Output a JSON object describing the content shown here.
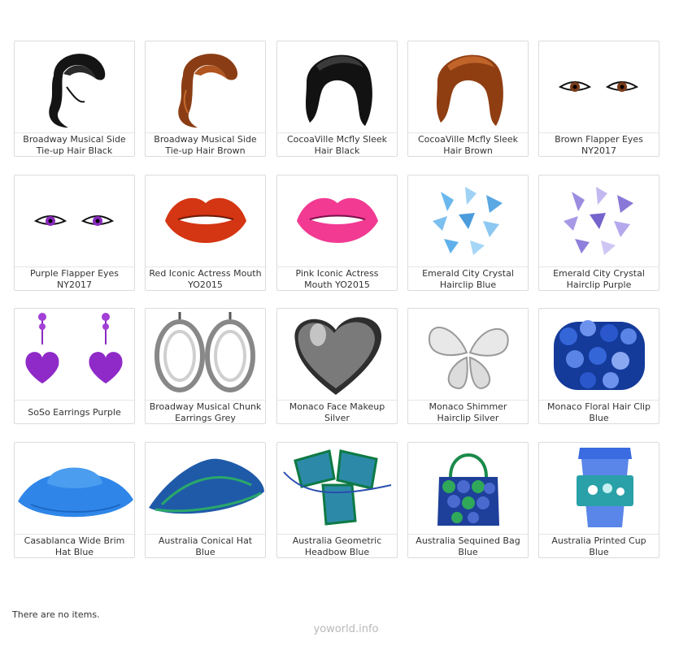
{
  "items": [
    {
      "name": "Broadway Musical Side Tie-up Hair Black",
      "icon": "black-side-hair-icon"
    },
    {
      "name": "Broadway Musical Side Tie-up Hair Brown",
      "icon": "brown-side-hair-icon"
    },
    {
      "name": "CocoaVille Mcfly Sleek Hair Black",
      "icon": "black-sleek-hair-icon"
    },
    {
      "name": "CocoaVille Mcfly Sleek Hair Brown",
      "icon": "brown-sleek-hair-icon"
    },
    {
      "name": "Brown Flapper Eyes NY2017",
      "icon": "brown-eyes-icon"
    },
    {
      "name": "Purple Flapper Eyes NY2017",
      "icon": "purple-eyes-icon"
    },
    {
      "name": "Red Iconic Actress Mouth YO2015",
      "icon": "red-lips-icon"
    },
    {
      "name": "Pink Iconic Actress Mouth YO2015",
      "icon": "pink-lips-icon"
    },
    {
      "name": "Emerald City Crystal Hairclip Blue",
      "icon": "blue-crystal-hairclip-icon"
    },
    {
      "name": "Emerald City Crystal Hairclip Purple",
      "icon": "purple-crystal-hairclip-icon"
    },
    {
      "name": "SoSo Earrings Purple",
      "icon": "purple-heart-earrings-icon"
    },
    {
      "name": "Broadway Musical Chunk Earrings Grey",
      "icon": "grey-chunk-earrings-icon"
    },
    {
      "name": "Monaco Face Makeup Silver",
      "icon": "silver-heart-makeup-icon"
    },
    {
      "name": "Monaco Shimmer Hairclip Silver",
      "icon": "silver-butterfly-hairclip-icon"
    },
    {
      "name": "Monaco Floral Hair Clip Blue",
      "icon": "blue-floral-hairclip-icon"
    },
    {
      "name": "Casablanca Wide Brim Hat Blue",
      "icon": "blue-wide-brim-hat-icon"
    },
    {
      "name": "Australia Conical Hat Blue",
      "icon": "blue-conical-hat-icon"
    },
    {
      "name": "Australia Geometric Headbow Blue",
      "icon": "blue-geometric-headbow-icon"
    },
    {
      "name": "Australia Sequined Bag Blue",
      "icon": "blue-sequined-bag-icon"
    },
    {
      "name": "Australia Printed Cup Blue",
      "icon": "blue-printed-cup-icon"
    }
  ],
  "empty_message": "There are no items.",
  "footer": "yoworld.info"
}
